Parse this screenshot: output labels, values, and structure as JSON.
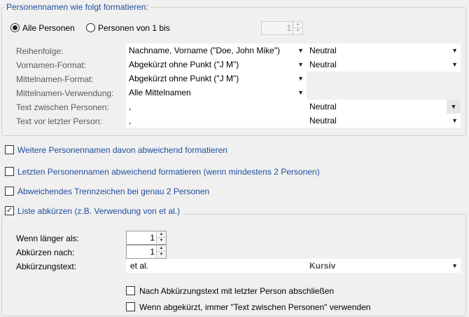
{
  "group1": {
    "title": "Personennamen wie folgt formatieren:",
    "radio_all": "Alle Personen",
    "radio_range": "Personen von 1 bis",
    "range_value": "1",
    "rows": [
      {
        "label": "Reihenfolge:",
        "value": "Nachname, Vorname (\"Doe, John Mike\")",
        "style": "Neutral"
      },
      {
        "label": "Vornamen-Format:",
        "value": "Abgekürzt ohne Punkt (\"J M\")",
        "style": "Neutral"
      },
      {
        "label": "Mittelnamen-Format:",
        "value": "Abgekürzt ohne Punkt (\"J M\")"
      },
      {
        "label": "Mittelnamen-Verwendung:",
        "value": "Alle Mittelnamen"
      },
      {
        "label": "Text zwischen Personen:",
        "value": ",",
        "style": "Neutral"
      },
      {
        "label": "Text vor letzter Person:",
        "value": ",",
        "style": "Neutral"
      }
    ]
  },
  "options": {
    "further": "Weitere Personennamen davon abweichend formatieren",
    "last": "Letzten Personennamen abweichend formatieren (wenn mindestens 2 Personen)",
    "separator": "Abweichendes Trennzeichen bei genau 2 Personen",
    "abbrev": "Liste abkürzen (z.B. Verwendung von et al.)"
  },
  "group2": {
    "longer_label": "Wenn länger als:",
    "longer_value": "1",
    "after_label": "Abkürzen nach:",
    "after_value": "1",
    "text_label": "Abkürzungstext:",
    "text_value": "et al.",
    "style_value": "Kursiv",
    "check_end": "Nach Abkürzungstext mit letzter Person abschließen",
    "check_always": "Wenn abgekürzt, immer \"Text zwischen Personen\" verwenden"
  },
  "icons": {
    "dropdown": "dropdown-arrow-icon",
    "spin_up": "spin-up-icon",
    "spin_down": "spin-down-icon",
    "check": "checkmark-icon"
  },
  "colors": {
    "background": "#f0f0f0",
    "heading_blue": "#1f4e9c"
  }
}
